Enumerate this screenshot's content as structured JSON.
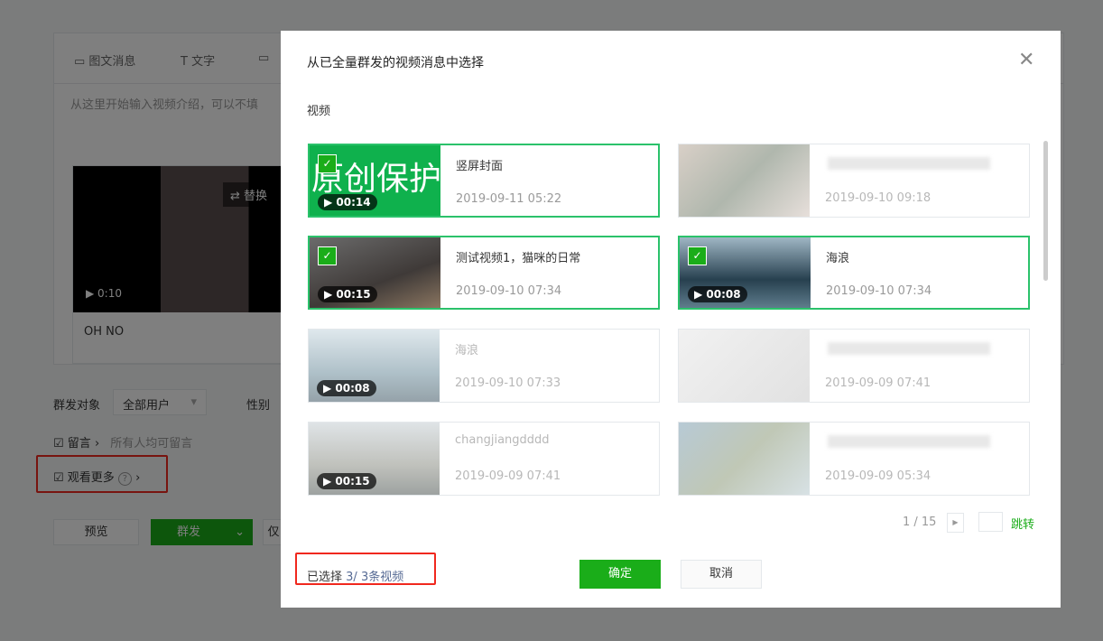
{
  "background": {
    "tabs": [
      {
        "icon": "image-text-icon",
        "label": "图文消息"
      },
      {
        "icon": "text-icon",
        "label": "文字"
      },
      {
        "icon": "image-icon",
        "label": ""
      }
    ],
    "intro_placeholder": "从这里开始输入视频介绍，可以不填",
    "video": {
      "duration": "0:10",
      "title": "OH NO",
      "replace_label": "替换"
    },
    "audience_label": "群发对象",
    "audience_value": "全部用户",
    "gender_label": "性别",
    "comment_label": "留言",
    "comment_desc": "所有人均可留言",
    "watch_more_label": "观看更多",
    "preview_label": "预览",
    "send_label": "群发",
    "extra_label": "仅"
  },
  "modal": {
    "title": "从已全量群发的视频消息中选择",
    "section_label": "视频",
    "videos": [
      {
        "title": "竖屏封面",
        "date": "2019-09-11 05:22",
        "duration": "00:14",
        "selected": true,
        "blurred": false
      },
      {
        "title": "",
        "date": "2019-09-10 09:18",
        "duration": "",
        "selected": false,
        "blurred": true
      },
      {
        "title": "测试视频1，猫咪的日常",
        "date": "2019-09-10 07:34",
        "duration": "00:15",
        "selected": true,
        "blurred": false
      },
      {
        "title": "海浪",
        "date": "2019-09-10 07:34",
        "duration": "00:08",
        "selected": true,
        "blurred": false
      },
      {
        "title": "海浪",
        "date": "2019-09-10 07:33",
        "duration": "00:08",
        "selected": false,
        "blurred": false
      },
      {
        "title": "",
        "date": "2019-09-09 07:41",
        "duration": "",
        "selected": false,
        "blurred": true
      },
      {
        "title": "changjiangdddd",
        "date": "2019-09-09 07:41",
        "duration": "00:15",
        "selected": false,
        "blurred": false
      },
      {
        "title": "",
        "date": "2019-09-09 05:34",
        "duration": "",
        "selected": false,
        "blurred": true
      }
    ],
    "thumb1_text": "原创保护",
    "pagination": {
      "current": "1 / 15",
      "jump_label": "跳转"
    },
    "selected_label": "已选择",
    "selected_count": "3/ 3条视频",
    "confirm_label": "确定",
    "cancel_label": "取消"
  },
  "colors": {
    "accent": "#1aad19",
    "link": "#576b95",
    "highlight": "#f0281e"
  }
}
